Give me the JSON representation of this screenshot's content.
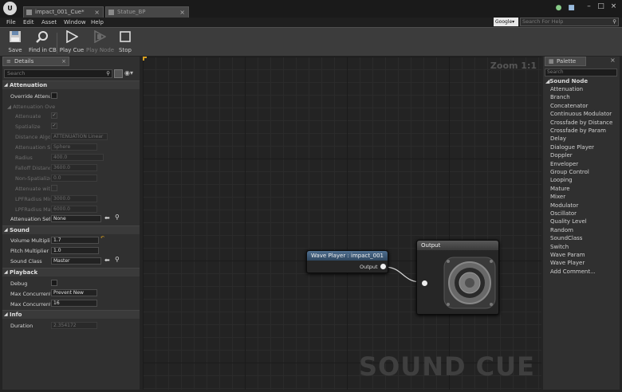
{
  "app": {
    "logo_text": "U"
  },
  "tabs": [
    {
      "label": "impact_001_Cue*",
      "active": true
    },
    {
      "label": "Statue_BP",
      "active": false
    }
  ],
  "menu": [
    "File",
    "Edit",
    "Asset",
    "Window",
    "Help"
  ],
  "help": {
    "engine": "Google▾",
    "placeholder": "Search For Help"
  },
  "toolbar": {
    "save": "Save",
    "find_in_cb": "Find in CB",
    "play_cue": "Play Cue",
    "play_node": "Play Node",
    "stop": "Stop"
  },
  "details": {
    "tab_label": "Details",
    "search_placeholder": "Search",
    "sections": {
      "attenuation": "Attenuation",
      "sound": "Sound",
      "playback": "Playback",
      "info": "Info"
    },
    "attenuation": {
      "override": "Override Attenua",
      "over_group": "Attenuation Over",
      "attenuate": "Attenuate",
      "spatialize": "Spatialize",
      "distance_algo_label": "Distance Algori",
      "distance_algo_value": "ATTENUATION Linear",
      "shape_label": "Attenuation Sh",
      "shape_value": "Sphere",
      "radius_label": "Radius",
      "radius_value": "400.0",
      "falloff_label": "Falloff Distanc",
      "falloff_value": "3600.0",
      "nonspat_label": "Non-Spatialize",
      "nonspat_value": "0.0",
      "attenuate_with": "Attenuate with",
      "lpf_min_label": "LPFRadius Min",
      "lpf_min_value": "3000.0",
      "lpf_max_label": "LPFRadius Max",
      "lpf_max_value": "6000.0",
      "settings_label": "Attenuation Setti",
      "settings_value": "None"
    },
    "sound": {
      "volume_label": "Volume Multiplie",
      "volume_value": "1.7",
      "pitch_label": "Pitch Multiplier",
      "pitch_value": "1.0",
      "class_label": "Sound Class",
      "class_value": "Master"
    },
    "playback": {
      "debug_label": "Debug",
      "max_rule_label": "Max Concurrent I",
      "max_rule_value": "Prevent New",
      "max_count_label": "Max Concurrent I",
      "max_count_value": "16"
    },
    "info": {
      "duration_label": "Duration",
      "duration_value": "2.354172"
    }
  },
  "graph": {
    "zoom": "Zoom 1:1",
    "watermark": "SOUND CUE",
    "wave_player": {
      "title": "Wave Player : impact_001",
      "pin": "Output"
    },
    "output": {
      "title": "Output"
    },
    "colors": {
      "wave_header": "#3c5a78",
      "output_header": "#4a4a4a",
      "wire": "#d8d8d8"
    }
  },
  "palette": {
    "tab_label": "Palette",
    "search_placeholder": "Search",
    "category": "Sound Node",
    "items": [
      "Attenuation",
      "Branch",
      "Concatenator",
      "Continuous Modulator",
      "Crossfade by Distance",
      "Crossfade by Param",
      "Delay",
      "Dialogue Player",
      "Doppler",
      "Enveloper",
      "Group Control",
      "Looping",
      "Mature",
      "Mixer",
      "Modulator",
      "Oscillator",
      "Quality Level",
      "Random",
      "SoundClass",
      "Switch",
      "Wave Param",
      "Wave Player",
      "Add Comment..."
    ]
  }
}
